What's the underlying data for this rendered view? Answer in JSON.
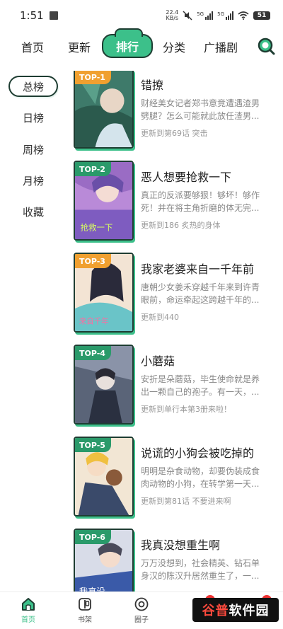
{
  "status_bar": {
    "time": "1:51",
    "speed_value": "22.4",
    "speed_unit": "KB/s",
    "sig1": "5G",
    "sig2": "5G",
    "battery": "51"
  },
  "top_nav": {
    "tabs": [
      {
        "label": "首页"
      },
      {
        "label": "更新"
      },
      {
        "label": "排行"
      },
      {
        "label": "分类"
      },
      {
        "label": "广播剧"
      }
    ],
    "active_index": 2,
    "icon": "search-icon"
  },
  "sidebar": {
    "items": [
      {
        "label": "总榜"
      },
      {
        "label": "日榜"
      },
      {
        "label": "周榜"
      },
      {
        "label": "月榜"
      },
      {
        "label": "收藏"
      }
    ],
    "active_index": 0
  },
  "ranking": [
    {
      "badge": "TOP-1",
      "title": "错撩",
      "desc": "财经美女记者郑书意竟遭遇渣男劈腿？怎么可能就此放任渣男...",
      "update": "更新到第69话 突击"
    },
    {
      "badge": "TOP-2",
      "title": "恶人想要抢救一下",
      "desc": "真正的反派要够狠！够坏！够作死！并在将主角折磨的体无完...",
      "update": "更新到186 炙热的身体"
    },
    {
      "badge": "TOP-3",
      "title": "我家老婆来自一千年前",
      "desc": "唐朝少女姜禾穿越千年来到许青眼前，命运牵起这跨越千年的...",
      "update": "更新到440"
    },
    {
      "badge": "TOP-4",
      "title": "小蘑菇",
      "desc": "安折是朵蘑菇，毕生使命就是养出一颗自己的孢子。有一天，...",
      "update": "更新到单行本第3册来啦！"
    },
    {
      "badge": "TOP-5",
      "title": "说谎的小狗会被吃掉的",
      "desc": "明明是杂食动物，却要伪装成食肉动物的小狗，在转学第一天...",
      "update": "更新到第81话 不要进来啊"
    },
    {
      "badge": "TOP-6",
      "title": "我真没想重生啊",
      "desc": "万万没想到，社会精英、钻石单身汉的陈汉升居然重生了，一...",
      "update": ""
    }
  ],
  "bottom_nav": {
    "tabs": [
      {
        "label": "首页",
        "icon": "home-icon"
      },
      {
        "label": "书架",
        "icon": "bookshelf-icon"
      },
      {
        "label": "圈子",
        "icon": "circle-icon"
      }
    ],
    "active_index": 0
  },
  "watermark": {
    "part1": "谷普",
    "part2": "软件园"
  },
  "colors": {
    "accent": "#3cc08a",
    "outline": "#1e3d32",
    "badge_orange": "#f0a030",
    "badge_green": "#2a9a6a",
    "badge_pink": "#e8739a"
  }
}
